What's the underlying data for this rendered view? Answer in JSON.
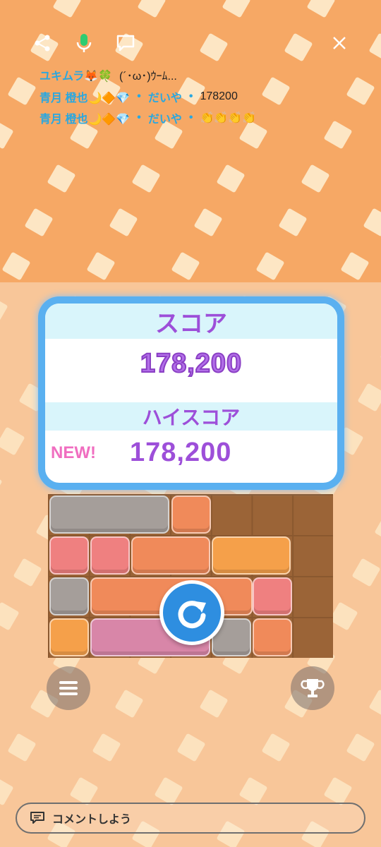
{
  "toolbar": {
    "share_icon": "share-icon",
    "mic_icon": "microphone-icon",
    "chat_icon": "chat-bubble-icon",
    "close_icon": "close-icon"
  },
  "comments": [
    {
      "user": "ユキムラ🦊🍀",
      "text": "(´･ω･)ｳｰﾑ..."
    },
    {
      "user": "青月 橙也🌙🔶💎",
      "dot": "•",
      "tag": "だいや",
      "text": "178200"
    },
    {
      "user": "青月 橙也🌙🔶💎",
      "dot": "•",
      "tag": "だいや",
      "text": "👏👏👏👏"
    }
  ],
  "score_panel": {
    "score_label": "スコア",
    "score_value": "178,200",
    "highscore_label": "ハイスコア",
    "new_badge": "NEW!",
    "highscore_value": "178,200"
  },
  "buttons": {
    "retry_icon": "retry-arrow-icon",
    "menu_icon": "menu-icon",
    "ranking_icon": "trophy-icon"
  },
  "comment_input": {
    "placeholder": "コメントしよう",
    "icon": "comment-icon"
  },
  "colors": {
    "bg_top": "#f6a865",
    "bg_bottom": "#f8c699",
    "panel_border": "#5ab0f0",
    "label_purple": "#9d4fd9",
    "new_pink": "#f06ec0",
    "user_blue": "#29a7e0"
  }
}
